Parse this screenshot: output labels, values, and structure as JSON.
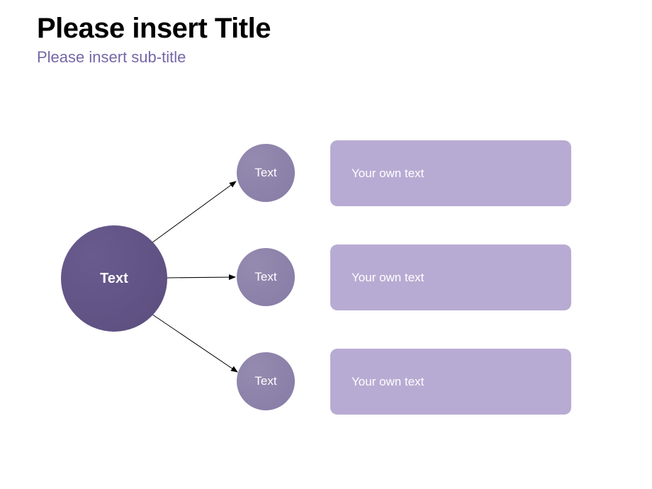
{
  "title": "Please insert Title",
  "subtitle": "Please insert sub-title",
  "mainNode": {
    "label": "Text"
  },
  "branches": [
    {
      "circleLabel": "Text",
      "boxText": "Your own text"
    },
    {
      "circleLabel": "Text",
      "boxText": "Your own text"
    },
    {
      "circleLabel": "Text",
      "boxText": "Your own text"
    }
  ],
  "colors": {
    "title": "#000000",
    "subtitle": "#7667a8",
    "mainCircle": "#5b4d7d",
    "subCircle": "#867ba5",
    "textBox": "#b8abd3",
    "textColor": "#ffffff",
    "arrow": "#000000"
  }
}
